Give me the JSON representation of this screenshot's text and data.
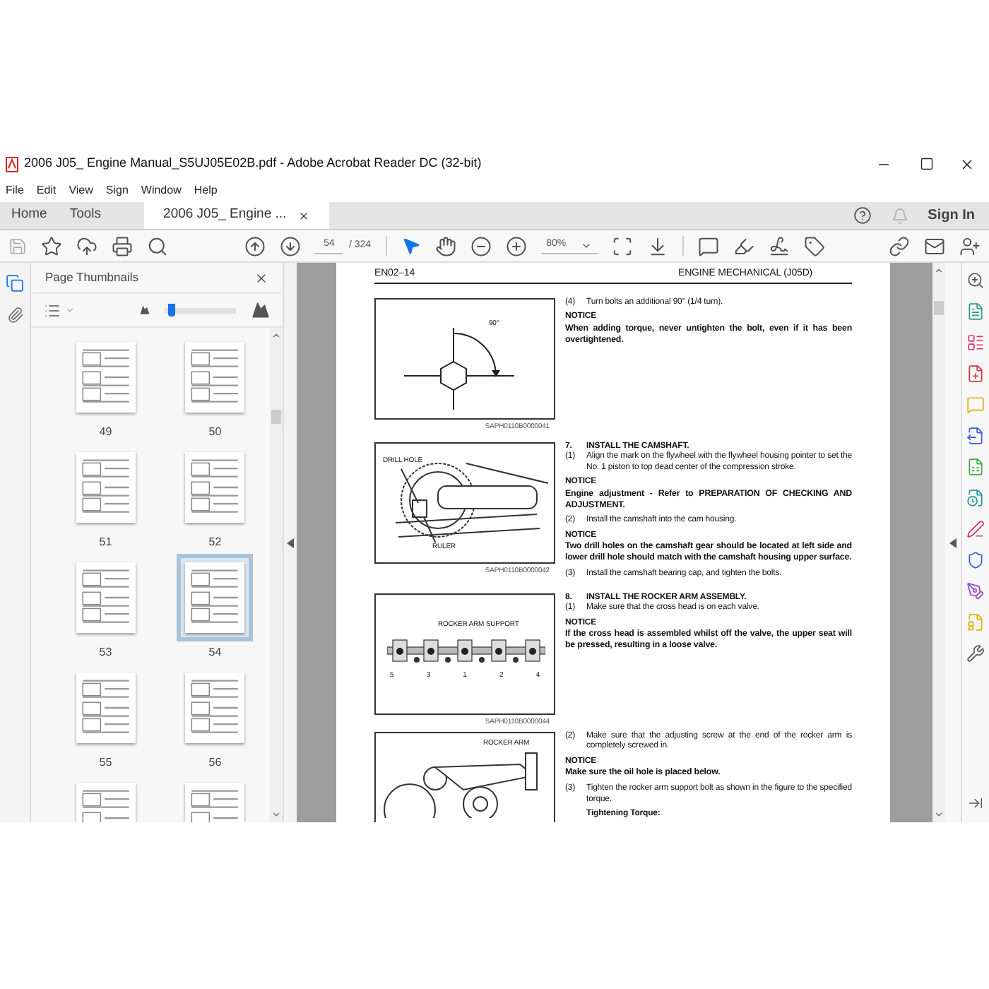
{
  "window": {
    "title": "2006 J05_ Engine Manual_S5UJ05E02B.pdf - Adobe Acrobat Reader DC (32-bit)"
  },
  "menu": [
    "File",
    "Edit",
    "View",
    "Sign",
    "Window",
    "Help"
  ],
  "tabs": [
    {
      "label": "Home",
      "selected": false
    },
    {
      "label": "Tools",
      "selected": false
    },
    {
      "label": "2006 J05_ Engine ...",
      "selected": true
    }
  ],
  "account": {
    "label": "Sign In"
  },
  "toolbar": {
    "page_current": "54",
    "page_total": "/ 324",
    "zoom": "80%"
  },
  "thumbnails": {
    "title": "Page Thumbnails",
    "size_slider": {
      "level": 0.05
    },
    "pages": [
      {
        "label": "49",
        "selected": false
      },
      {
        "label": "50",
        "selected": false
      },
      {
        "label": "51",
        "selected": false
      },
      {
        "label": "52",
        "selected": false
      },
      {
        "label": "53",
        "selected": false
      },
      {
        "label": "54",
        "selected": true
      },
      {
        "label": "55",
        "selected": false
      },
      {
        "label": "56",
        "selected": false
      },
      {
        "selected": false
      },
      {
        "selected": false
      }
    ]
  },
  "document": {
    "header_left": "EN02–14",
    "header_right": "ENGINE MECHANICAL (J05D)",
    "rows": [
      {
        "figure": {
          "kind": "angle",
          "labels": [
            "90°"
          ],
          "caption": "SAPH0110B0000041"
        },
        "text": [
          {
            "kind": "step",
            "num": "(4)",
            "text": "Turn bolts an additional 90° (1/4 turn)."
          },
          {
            "kind": "notice",
            "text": "NOTICE"
          },
          {
            "kind": "bold",
            "text": "When adding torque, never untighten the bolt, even if it has been overtightened."
          }
        ]
      },
      {
        "figure": {
          "kind": "camshaft",
          "labels": [
            "DRILL HOLE",
            "RULER"
          ],
          "caption": "SAPH0110B0000042"
        },
        "text": [
          {
            "kind": "heading",
            "num": "7.",
            "text": "INSTALL THE CAMSHAFT."
          },
          {
            "kind": "step",
            "num": "(1)",
            "text": "Align the mark on the flywheel with the flywheel housing pointer to set the No. 1 piston to top dead center of the compression stroke."
          },
          {
            "kind": "notice",
            "text": "NOTICE"
          },
          {
            "kind": "bold",
            "text": "Engine adjustment - Refer to PREPARATION OF CHECKING AND ADJUSTMENT."
          },
          {
            "kind": "step",
            "num": "(2)",
            "text": "Install the camshaft into the cam housing."
          },
          {
            "kind": "notice",
            "text": "NOTICE"
          },
          {
            "kind": "bold",
            "text": "Two drill holes on the camshaft gear should be located at left side and lower drill hole should match with the camshaft housing upper surface."
          },
          {
            "kind": "step",
            "num": "(3)",
            "text": "Install the camshaft bearing cap, and tighten the bolts."
          }
        ]
      },
      {
        "figure": {
          "kind": "rocker_support",
          "labels": [
            "ROCKER ARM SUPPORT",
            "5",
            "3",
            "1",
            "2",
            "4"
          ],
          "caption": "SAPH0110B0000044"
        },
        "text": [
          {
            "kind": "heading",
            "num": "8.",
            "text": "INSTALL THE ROCKER ARM ASSEMBLY."
          },
          {
            "kind": "step",
            "num": "(1)",
            "text": "Make sure that the cross head is on each valve."
          },
          {
            "kind": "notice",
            "text": "NOTICE"
          },
          {
            "kind": "bold",
            "text": "If the cross head is assembled whilst off the valve, the upper seat will be pressed, resulting in a loose valve."
          }
        ]
      },
      {
        "figure": {
          "kind": "rocker_arm",
          "labels": [
            "ROCKER ARM"
          ]
        },
        "text": [
          {
            "kind": "step",
            "num": "(2)",
            "text": "Make sure that the adjusting screw at the end of the rocker arm is completely screwed in."
          },
          {
            "kind": "notice",
            "text": "NOTICE"
          },
          {
            "kind": "bold",
            "text": "Make sure the oil hole is placed below."
          },
          {
            "kind": "step",
            "num": "(3)",
            "text": "Tighten the rocker arm support bolt as shown in the figure to the specified torque."
          },
          {
            "kind": "subheading",
            "text": "Tightening Torque:"
          }
        ]
      }
    ]
  }
}
